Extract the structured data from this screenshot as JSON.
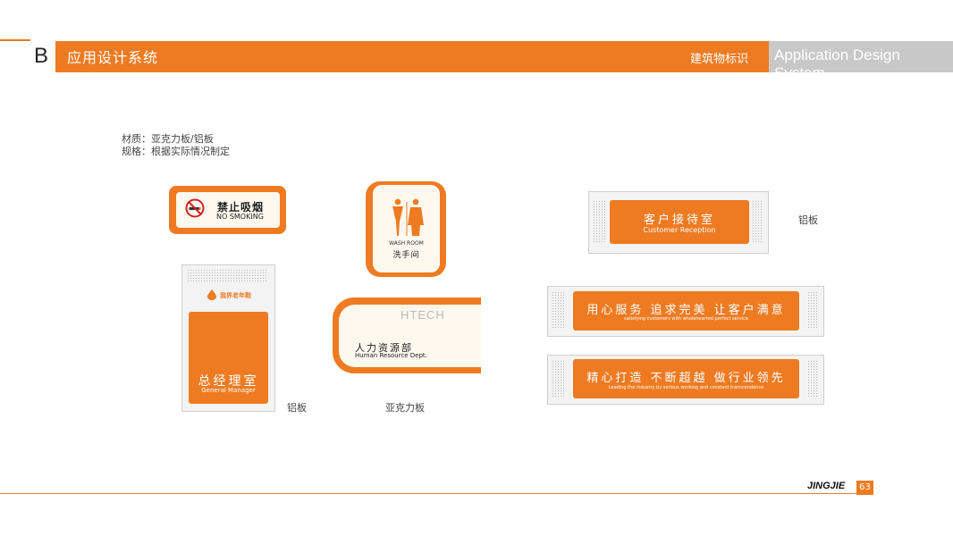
{
  "header": {
    "letter": "B",
    "title": "应用设计系统",
    "section": "建筑物标识",
    "english": "Application Design System"
  },
  "spec": {
    "material": "材质：亚克力板/铝板",
    "size": "规格：根据实际情况制定"
  },
  "signs": {
    "no_smoking": {
      "cn": "禁止吸烟",
      "en": "NO SMOKING"
    },
    "washroom": {
      "en": "WASH ROOM",
      "cn": "洗手间"
    },
    "general_manager": {
      "logo_text": "我界老年鞋",
      "cn": "总经理室",
      "en": "General Manager",
      "material": "铝板"
    },
    "hr": {
      "logo": "HTECH",
      "cn": "人力资源部",
      "en": "Human Resource Dept.",
      "material": "亚克力板"
    },
    "reception": {
      "cn": "客户接待室",
      "en": "Customer Reception",
      "material": "铝板"
    },
    "slogan1": {
      "cn": "用心服务 追求完美 让客户满意",
      "en": "satisfying customers with wholehearted perfect service"
    },
    "slogan2": {
      "cn": "精心打造 不断超越 做行业领先",
      "en": "Leading the industry by serious working and constant transcendence"
    }
  },
  "footer": {
    "brand": "JINGJIE",
    "page": "63"
  },
  "colors": {
    "accent": "#ee7b22",
    "header_grey": "#c8c8c8"
  }
}
